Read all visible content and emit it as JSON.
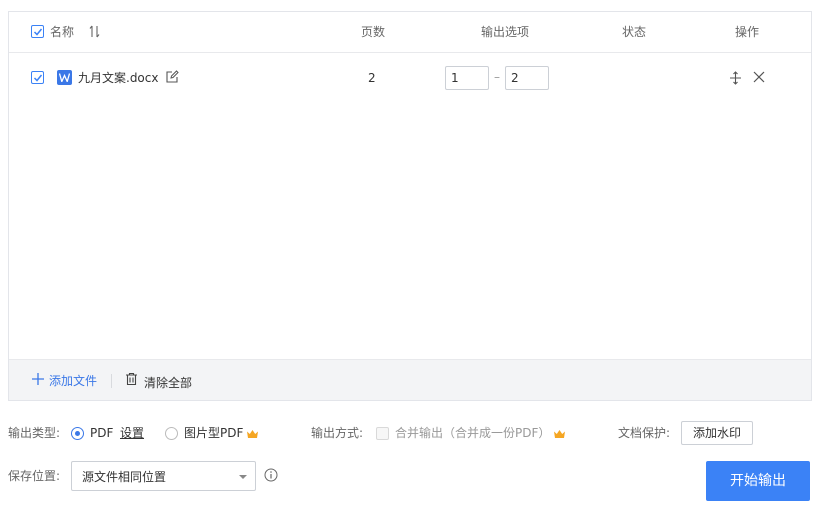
{
  "table": {
    "headers": {
      "name": "名称",
      "pages": "页数",
      "output_options": "输出选项",
      "status": "状态",
      "actions": "操作"
    },
    "rows": [
      {
        "checked": true,
        "file_name": "九月文案.docx",
        "pages": "2",
        "range_from": "1",
        "range_to": "2",
        "status": ""
      }
    ]
  },
  "footer": {
    "add_file": "添加文件",
    "clear_all": "清除全部"
  },
  "options": {
    "output_type_label": "输出类型:",
    "pdf_label": "PDF",
    "settings_link": "设置",
    "image_pdf_label": "图片型PDF",
    "output_mode_label": "输出方式:",
    "merge_label": "合并输出（合并成一份PDF）",
    "protect_label": "文档保护:",
    "watermark_button": "添加水印",
    "save_location_label": "保存位置:",
    "save_location_value": "源文件相同位置",
    "start_button": "开始输出"
  },
  "colors": {
    "accent": "#3b82f6",
    "crown": "#f5a623"
  },
  "icons": [
    "checkbox-checked-icon",
    "sort-icon",
    "word-doc-icon",
    "edit-icon",
    "move-icon",
    "close-icon",
    "plus-icon",
    "trash-icon",
    "crown-icon",
    "info-icon",
    "caret-down-icon"
  ]
}
